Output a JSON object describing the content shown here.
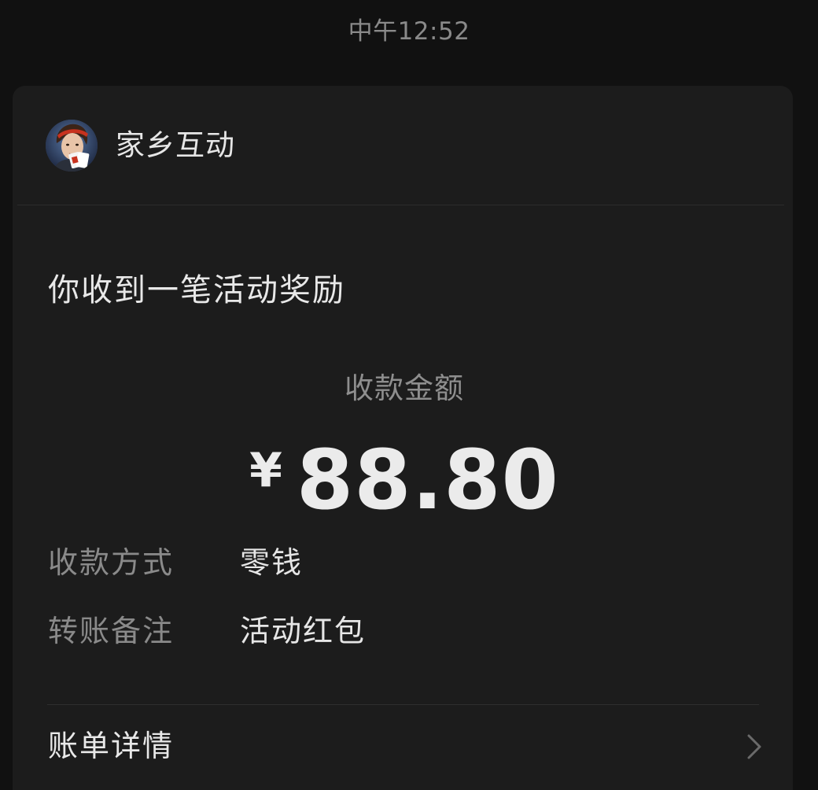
{
  "status": {
    "time": "中午12:52"
  },
  "sender": {
    "name": "家乡互动",
    "avatar_icon": "card-player-avatar"
  },
  "message": {
    "title": "你收到一笔活动奖励"
  },
  "payment": {
    "amount_label": "收款金额",
    "currency_symbol": "¥",
    "amount": "88.80"
  },
  "details": [
    {
      "key": "收款方式",
      "value": "零钱"
    },
    {
      "key": "转账备注",
      "value": "活动红包"
    }
  ],
  "footer": {
    "bill_label": "账单详情",
    "chevron_icon": "chevron-right-icon"
  },
  "colors": {
    "background": "#111111",
    "card": "#1c1c1c",
    "primary_text": "#e8e8e8",
    "secondary_text": "#8a8a8a"
  }
}
